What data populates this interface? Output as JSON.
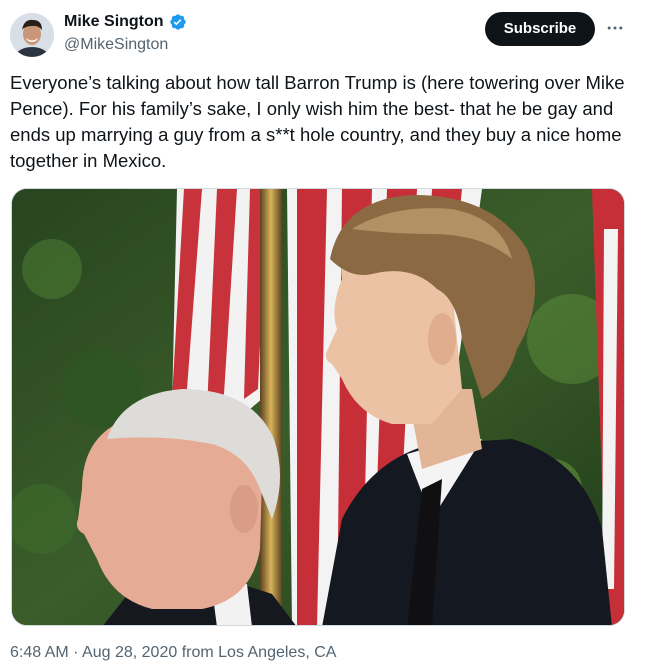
{
  "author": {
    "display_name": "Mike Sington",
    "handle": "@MikeSington",
    "verified": true
  },
  "actions": {
    "subscribe_label": "Subscribe",
    "more_icon": "more-horizontal-icon"
  },
  "tweet": {
    "text": "Everyone’s talking about how tall Barron Trump is (here towering over Mike Pence). For his family’s sake, I only wish him the best- that he be gay and ends up marrying a guy from a s**t hole country, and they buy a nice home together in Mexico."
  },
  "meta": {
    "time": "6:48 AM",
    "separator": " · ",
    "date": "Aug 28, 2020",
    "location": " from Los Angeles, CA"
  },
  "colors": {
    "text_primary": "#0f1419",
    "text_secondary": "#536471",
    "verified_blue": "#1d9bf0",
    "button_bg": "#0f1419"
  }
}
